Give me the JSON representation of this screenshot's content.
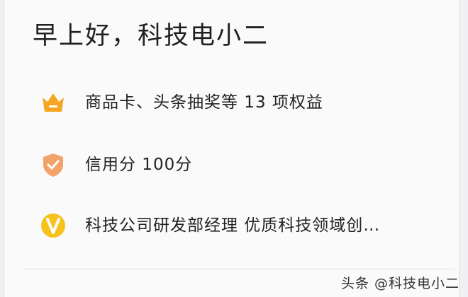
{
  "profile": {
    "greeting": "早上好，科技电小二"
  },
  "benefits": [
    {
      "icon": "crown-icon",
      "color": "#f5a623",
      "label": "商品卡、头条抽奖等 13 项权益"
    },
    {
      "icon": "shield-check-icon",
      "color": "#f3a36a",
      "label": "信用分  100分"
    },
    {
      "icon": "verified-v-icon",
      "color": "#f7c21b",
      "label": "科技公司研发部经理 优质科技领域创…"
    }
  ],
  "watermark": "头条 @科技电小二"
}
